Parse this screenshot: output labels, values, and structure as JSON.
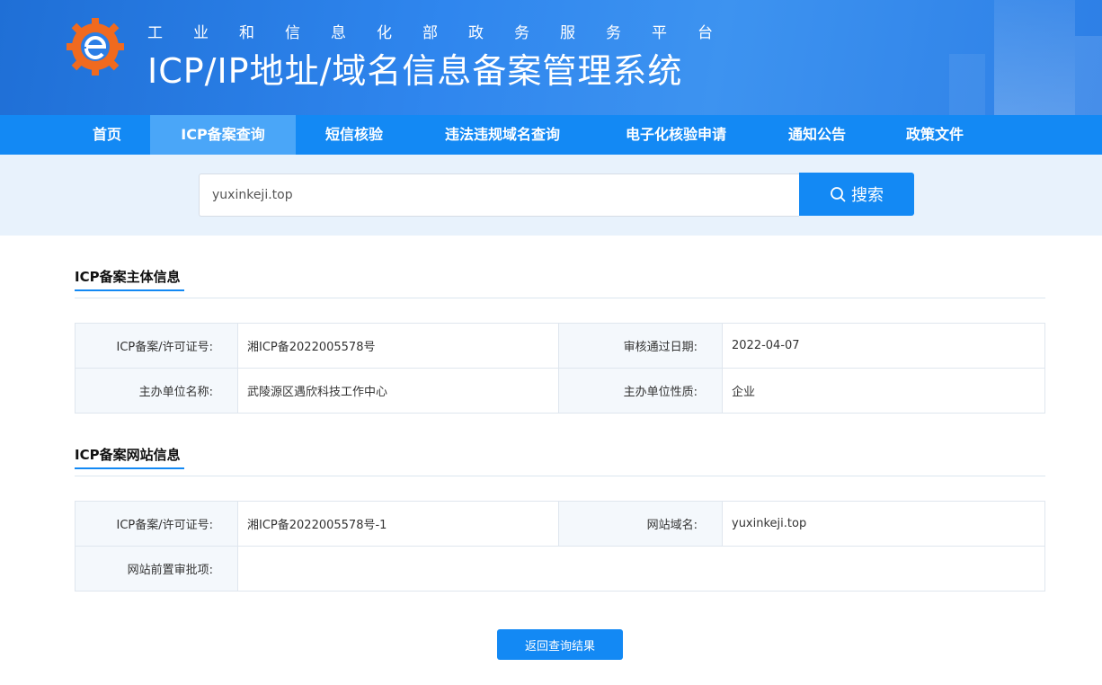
{
  "header": {
    "subtitle": "工业和信息化部政务服务平台",
    "title": "ICP/IP地址/域名信息备案管理系统"
  },
  "nav": {
    "items": [
      {
        "label": "首页"
      },
      {
        "label": "ICP备案查询",
        "active": true
      },
      {
        "label": "短信核验"
      },
      {
        "label": "违法违规域名查询"
      },
      {
        "label": "电子化核验申请"
      },
      {
        "label": "通知公告"
      },
      {
        "label": "政策文件"
      }
    ]
  },
  "search": {
    "value": "yuxinkeji.top",
    "button_label": "搜索",
    "button_icon": "search-icon"
  },
  "subject_info": {
    "section_title": "ICP备案主体信息",
    "license_label": "ICP备案/许可证号:",
    "license_value": "湘ICP备2022005578号",
    "approve_date_label": "审核通过日期:",
    "approve_date_value": "2022-04-07",
    "org_name_label": "主办单位名称:",
    "org_name_value": "武陵源区遇欣科技工作中心",
    "org_type_label": "主办单位性质:",
    "org_type_value": "企业"
  },
  "site_info": {
    "section_title": "ICP备案网站信息",
    "license_label": "ICP备案/许可证号:",
    "license_value": "湘ICP备2022005578号-1",
    "domain_label": "网站域名:",
    "domain_value": "yuxinkeji.top",
    "preapproval_label": "网站前置审批项:",
    "preapproval_value": ""
  },
  "back_button": {
    "label": "返回查询结果"
  },
  "colors": {
    "primary": "#1389f4",
    "banner": "#2f86ee",
    "logo_orange": "#f06a1f"
  }
}
